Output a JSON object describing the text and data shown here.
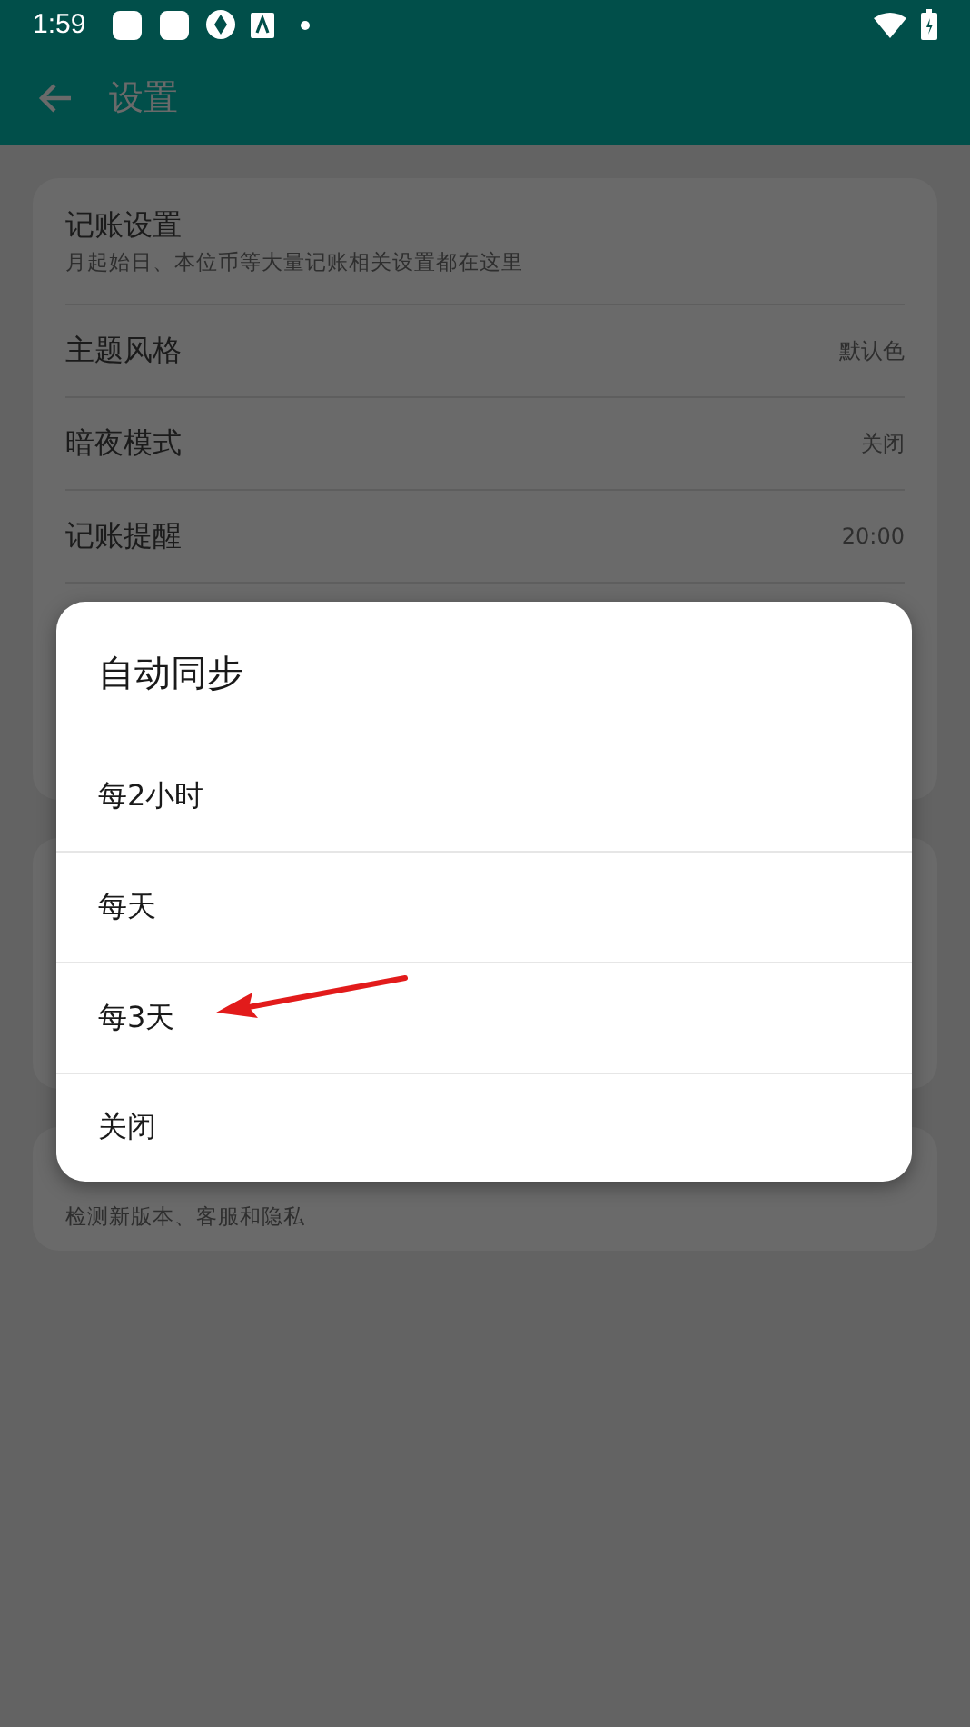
{
  "status_bar": {
    "time": "1:59"
  },
  "app_bar": {
    "title": "设置"
  },
  "settings": [
    {
      "title": "记账设置",
      "subtitle": "月起始日、本位币等大量记账相关设置都在这里"
    },
    {
      "title": "主题风格",
      "value": "默认色"
    },
    {
      "title": "暗夜模式",
      "value": "关闭"
    },
    {
      "title": "记账提醒",
      "value": "20:00"
    }
  ],
  "about": {
    "subtitle": "检测新版本、客服和隐私"
  },
  "dialog": {
    "title": "自动同步",
    "options": [
      {
        "label": "每2小时",
        "kind": "plain"
      },
      {
        "label": "每天",
        "kind": "plain"
      },
      {
        "label": "每3天",
        "kind": "arrowed"
      },
      {
        "label": "关闭",
        "kind": "plain"
      }
    ]
  }
}
